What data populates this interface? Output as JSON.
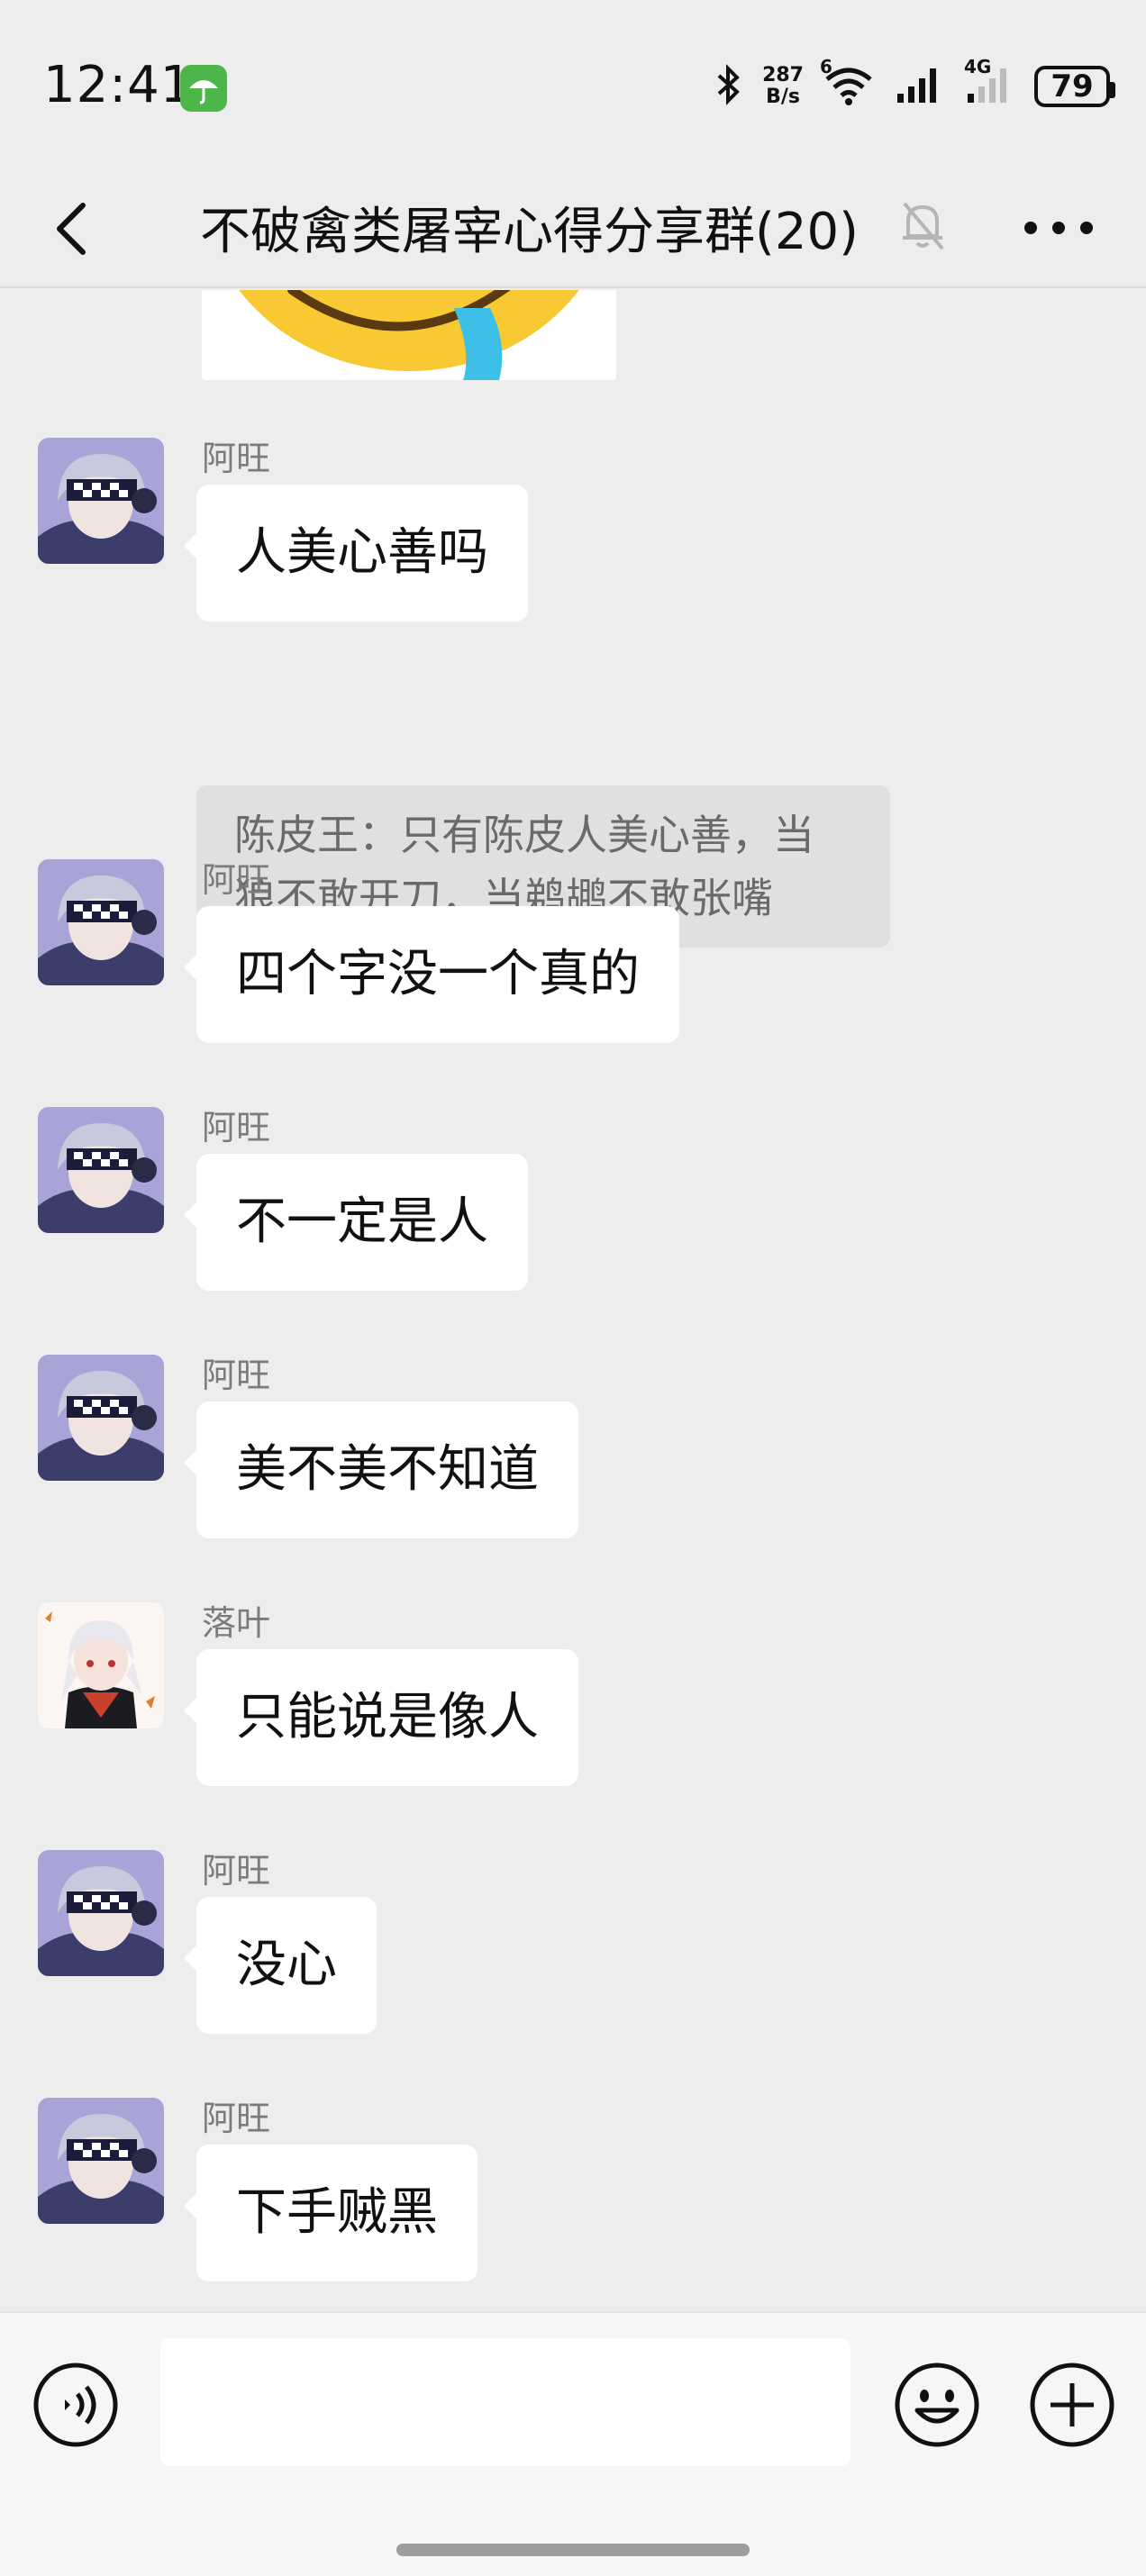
{
  "status_bar": {
    "time": "12:41",
    "net_speed_value": "287",
    "net_speed_unit": "B/s",
    "wifi_badge": "6",
    "cell_badge": "4G",
    "battery": "79"
  },
  "nav": {
    "title": "不破禽类屠宰心得分享群(20)"
  },
  "messages": [
    {
      "sender": "阿旺",
      "text": "人美心善吗",
      "avatar": "anime-avatar-silver"
    },
    {
      "sender": "阿旺",
      "text": "四个字没一个真的",
      "avatar": "anime-avatar-silver"
    },
    {
      "sender": "阿旺",
      "text": "不一定是人",
      "avatar": "anime-avatar-silver"
    },
    {
      "sender": "阿旺",
      "text": "美不美不知道",
      "avatar": "anime-avatar-silver"
    },
    {
      "sender": "落叶",
      "text": "只能说是像人",
      "avatar": "anime-avatar-white-hair"
    },
    {
      "sender": "阿旺",
      "text": "没心",
      "avatar": "anime-avatar-silver"
    },
    {
      "sender": "阿旺",
      "text": "下手贼黑",
      "avatar": "anime-avatar-silver"
    }
  ],
  "quote": {
    "text": "陈皮王：只有陈皮人美心善，当狼不敢开刀，当鹈鹕不敢张嘴"
  },
  "icons": {
    "back": "back-chevron-icon",
    "mute": "bell-muted-icon",
    "more": "more-dots-icon",
    "voice": "voice-icon",
    "emoji": "emoji-icon",
    "plus": "plus-icon"
  },
  "colors": {
    "background": "#ededed",
    "bubble": "#ffffff",
    "quote_bg": "#e0e0e0",
    "app_icon": "#4cb648"
  }
}
